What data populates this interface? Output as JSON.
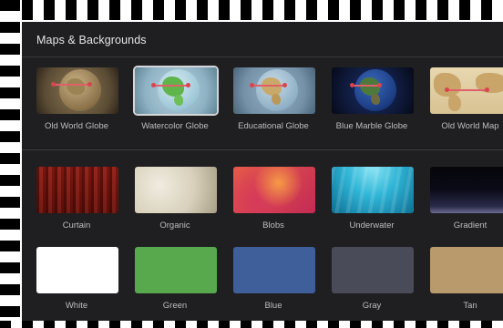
{
  "panel": {
    "title": "Maps & Backgrounds"
  },
  "maps": [
    {
      "label": "Old World Globe",
      "selected": false
    },
    {
      "label": "Watercolor Globe",
      "selected": true
    },
    {
      "label": "Educational Globe",
      "selected": false
    },
    {
      "label": "Blue Marble Globe",
      "selected": false
    },
    {
      "label": "Old World Map",
      "selected": false
    }
  ],
  "backgrounds_row1": [
    {
      "label": "Curtain",
      "color": "#7a140c"
    },
    {
      "label": "Organic",
      "color": "#d9d2be"
    },
    {
      "label": "Blobs",
      "color": "#e04a4e"
    },
    {
      "label": "Underwater",
      "color": "#2fb5d6"
    },
    {
      "label": "Gradient",
      "color": "#0b0b18"
    }
  ],
  "backgrounds_row2": [
    {
      "label": "White",
      "color": "#ffffff"
    },
    {
      "label": "Green",
      "color": "#58a84d"
    },
    {
      "label": "Blue",
      "color": "#3f5f9a"
    },
    {
      "label": "Gray",
      "color": "#494c58"
    },
    {
      "label": "Tan",
      "color": "#b99a6c"
    }
  ]
}
